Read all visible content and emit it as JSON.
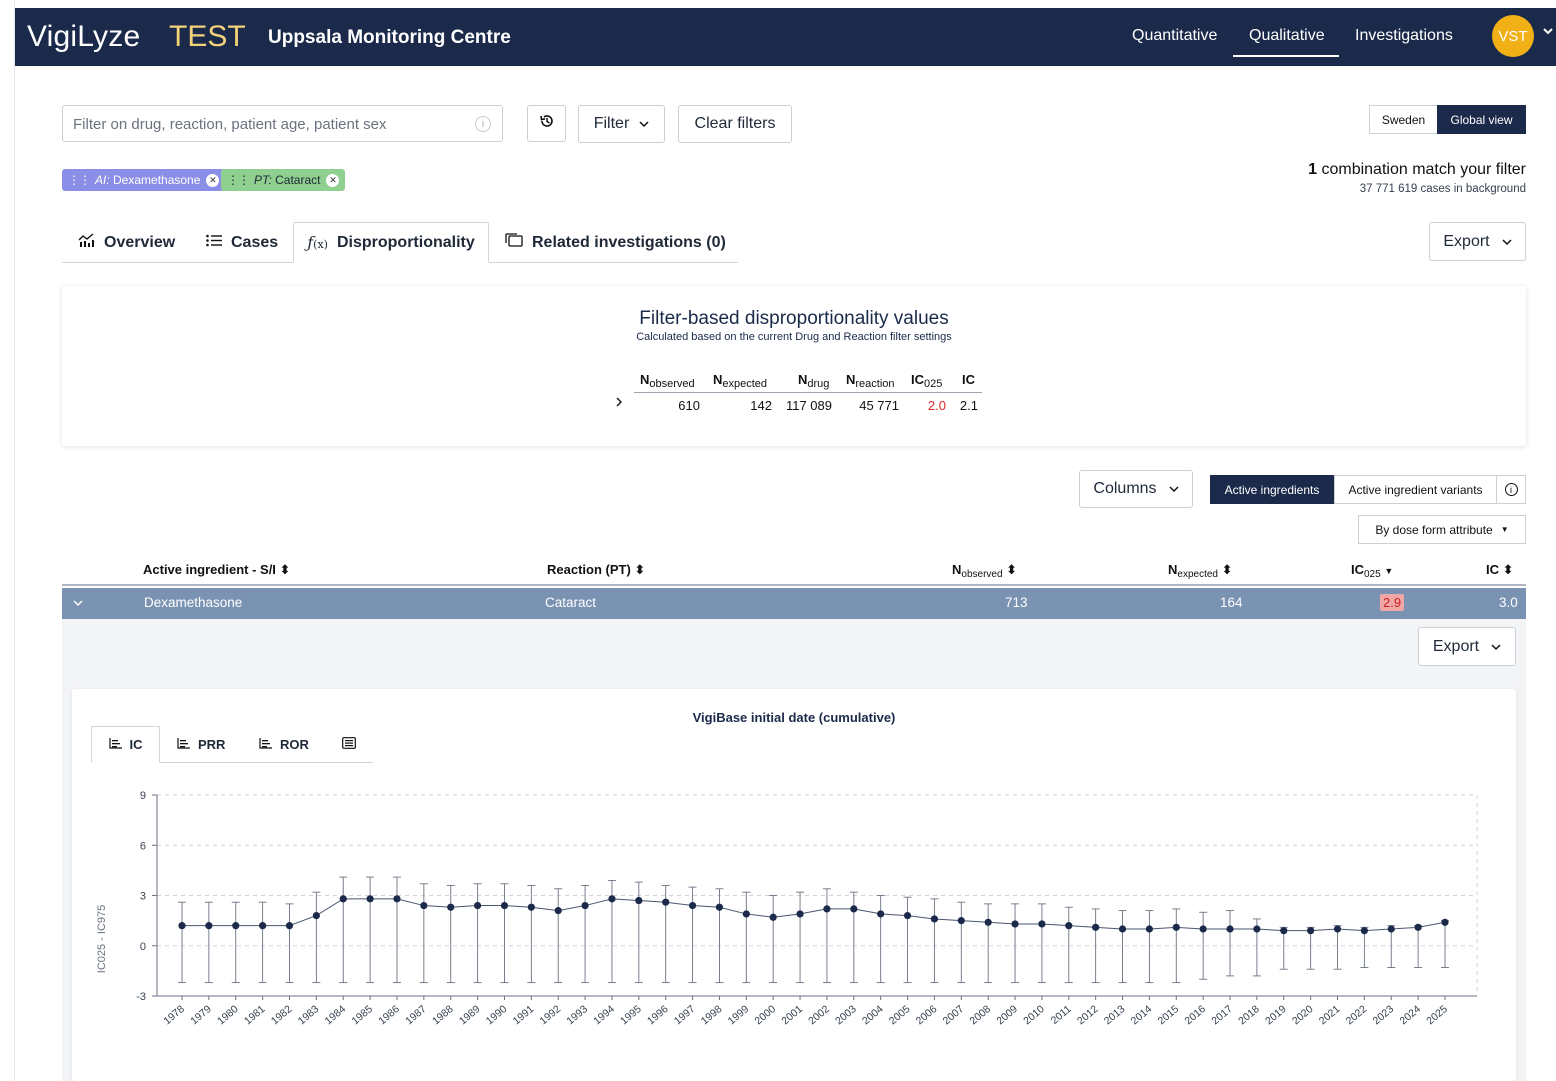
{
  "app": {
    "brand": "VigiLyze",
    "env_label": "TEST",
    "org": "Uppsala Monitoring Centre",
    "nav": [
      {
        "label": "Quantitative",
        "active": false
      },
      {
        "label": "Qualitative",
        "active": true
      },
      {
        "label": "Investigations",
        "active": false
      }
    ],
    "user_initials": "VST",
    "accent_color": "#f0b016",
    "header_color": "#1b2a4a"
  },
  "toolbar": {
    "search_placeholder": "Filter on drug, reaction, patient age, patient sex",
    "history_icon": "history-icon",
    "filter_label": "Filter",
    "clear_filters_label": "Clear filters",
    "scope_options": [
      {
        "label": "Sweden",
        "active": false
      },
      {
        "label": "Global view",
        "active": true
      }
    ]
  },
  "chips": [
    {
      "prefix": "AI:",
      "value": "Dexamethasone",
      "color": "#8b8ee6"
    },
    {
      "prefix": "PT:",
      "value": "Cataract",
      "color": "#8fcf8f"
    }
  ],
  "match": {
    "count": "1",
    "text": "combination match your filter",
    "background": "37 771 619 cases in background"
  },
  "tabs": [
    {
      "label": "Overview",
      "icon": "chart-icon"
    },
    {
      "label": "Cases",
      "icon": "list-icon"
    },
    {
      "label": "Disproportionality",
      "icon": "function-icon",
      "active": true
    },
    {
      "label": "Related investigations (0)",
      "icon": "folders-icon"
    }
  ],
  "export_label": "Export",
  "summary": {
    "title": "Filter-based disproportionality values",
    "subtitle": "Calculated based on the current Drug and Reaction filter settings",
    "headers": [
      {
        "main": "N",
        "sub": "observed"
      },
      {
        "main": "N",
        "sub": "expected"
      },
      {
        "main": "N",
        "sub": "drug"
      },
      {
        "main": "N",
        "sub": "reaction"
      },
      {
        "main": "IC",
        "sub": "025"
      },
      {
        "main": "IC",
        "sub": ""
      }
    ],
    "values": [
      "610",
      "142",
      "117 089",
      "45 771",
      "2.0",
      "2.1"
    ],
    "ic025_color": "#e02424"
  },
  "grid_controls": {
    "columns_label": "Columns",
    "view_options": [
      {
        "label": "Active ingredients",
        "active": true
      },
      {
        "label": "Active ingredient variants",
        "active": false
      }
    ],
    "dose_form_label": "By dose form attribute"
  },
  "grid": {
    "headers": {
      "ingredient": "Active ingredient - S/I",
      "reaction": "Reaction (PT)",
      "nobs_main": "N",
      "nobs_sub": "observed",
      "nexp_main": "N",
      "nexp_sub": "expected",
      "ic025_main": "IC",
      "ic025_sub": "025",
      "ic": "IC"
    },
    "row": {
      "ingredient": "Dexamethasone",
      "reaction": "Cataract",
      "nobs": "713",
      "nexp": "164",
      "ic025": "2.9",
      "ic": "3.0"
    }
  },
  "detail": {
    "export_label": "Export",
    "chart_tabs": [
      {
        "label": "IC",
        "active": true
      },
      {
        "label": "PRR",
        "active": false
      },
      {
        "label": "ROR",
        "active": false
      },
      {
        "label": "",
        "icon": "table-icon",
        "active": false
      }
    ]
  },
  "chart_data": {
    "type": "line",
    "title": "VigiBase initial date (cumulative)",
    "ylabel": "IC025 - IC975",
    "xlabel": "",
    "ylim": [
      -3,
      9
    ],
    "yticks": [
      -3,
      0,
      3,
      6,
      9
    ],
    "grid": true,
    "color": "#1b2a4a",
    "x": [
      "1978",
      "1979",
      "1980",
      "1981",
      "1982",
      "1983",
      "1984",
      "1985",
      "1986",
      "1987",
      "1988",
      "1989",
      "1990",
      "1991",
      "1992",
      "1993",
      "1994",
      "1995",
      "1996",
      "1997",
      "1998",
      "1999",
      "2000",
      "2001",
      "2002",
      "2003",
      "2004",
      "2005",
      "2006",
      "2007",
      "2008",
      "2009",
      "2010",
      "2011",
      "2012",
      "2013",
      "2014",
      "2015",
      "2016",
      "2017",
      "2018",
      "2019",
      "2020",
      "2021",
      "2022",
      "2023",
      "2024",
      "2025"
    ],
    "ic": [
      1.2,
      1.2,
      1.2,
      1.2,
      1.2,
      1.8,
      2.8,
      2.8,
      2.8,
      2.4,
      2.3,
      2.4,
      2.4,
      2.3,
      2.1,
      2.4,
      2.8,
      2.7,
      2.6,
      2.4,
      2.3,
      1.9,
      1.7,
      1.9,
      2.2,
      2.2,
      1.9,
      1.8,
      1.6,
      1.5,
      1.4,
      1.3,
      1.3,
      1.2,
      1.1,
      1.0,
      1.0,
      1.1,
      1.0,
      1.0,
      1.0,
      0.9,
      0.9,
      1.0,
      0.9,
      1.0,
      1.1,
      1.4
    ],
    "lower": [
      -2.2,
      -2.2,
      -2.2,
      -2.2,
      -2.2,
      -2.2,
      -2.2,
      -2.2,
      -2.2,
      -2.2,
      -2.2,
      -2.2,
      -2.2,
      -2.2,
      -2.2,
      -2.2,
      -2.2,
      -2.2,
      -2.2,
      -2.2,
      -2.2,
      -2.2,
      -2.2,
      -2.2,
      -2.2,
      -2.2,
      -2.2,
      -2.2,
      -2.2,
      -2.2,
      -2.2,
      -2.2,
      -2.2,
      -2.2,
      -2.2,
      -2.2,
      -2.2,
      -2.2,
      -2.0,
      -1.8,
      -1.8,
      -1.4,
      -1.4,
      -1.4,
      -1.3,
      -1.3,
      -1.3,
      -1.3
    ],
    "upper": [
      2.6,
      2.6,
      2.6,
      2.6,
      2.5,
      3.2,
      4.1,
      4.1,
      4.1,
      3.7,
      3.6,
      3.7,
      3.7,
      3.6,
      3.4,
      3.6,
      3.9,
      3.8,
      3.6,
      3.5,
      3.4,
      3.2,
      3.0,
      3.2,
      3.4,
      3.2,
      3.0,
      2.9,
      2.8,
      2.6,
      2.5,
      2.5,
      2.5,
      2.3,
      2.2,
      2.1,
      2.1,
      2.2,
      2.0,
      2.1,
      1.6,
      1.1,
      1.1,
      1.2,
      1.1,
      1.2,
      1.2,
      1.5
    ]
  }
}
